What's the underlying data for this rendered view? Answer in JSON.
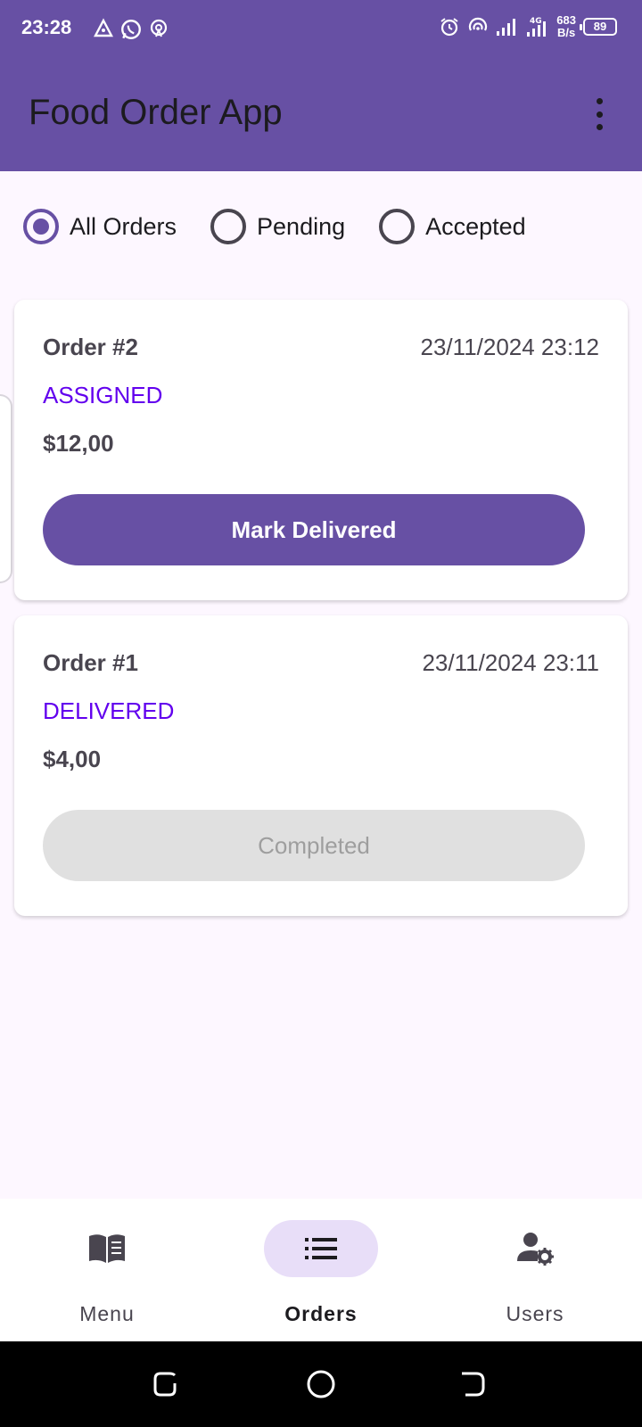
{
  "status_bar": {
    "time": "23:28",
    "left_icons": [
      "navigation-icon",
      "whatsapp-icon",
      "hotspot-icon"
    ],
    "right_icons": [
      "alarm-icon",
      "wifi-hotspot-icon",
      "signal-icon",
      "signal-4g-icon"
    ],
    "net_speed_value": "683",
    "net_speed_unit": "B/s",
    "battery": "89"
  },
  "app_bar": {
    "title": "Food Order App",
    "menu_icon": "more-vert-icon"
  },
  "filters": {
    "options": [
      {
        "label": "All Orders",
        "checked": true
      },
      {
        "label": "Pending",
        "checked": false
      },
      {
        "label": "Accepted",
        "checked": false
      }
    ]
  },
  "orders": [
    {
      "id": "Order #2",
      "datetime": "23/11/2024 23:12",
      "status": "ASSIGNED",
      "price": "$12,00",
      "action": "Mark Delivered",
      "action_enabled": true
    },
    {
      "id": "Order #1",
      "datetime": "23/11/2024 23:11",
      "status": "DELIVERED",
      "price": "$4,00",
      "action": "Completed",
      "action_enabled": false
    }
  ],
  "bottom_nav": {
    "items": [
      {
        "label": "Menu",
        "icon": "menu-book-icon",
        "active": false
      },
      {
        "label": "Orders",
        "icon": "list-icon",
        "active": true
      },
      {
        "label": "Users",
        "icon": "manage-accounts-icon",
        "active": false
      }
    ]
  },
  "colors": {
    "primary": "#6750a4",
    "status_text": "#6200ee",
    "nav_active_pill": "#e8def8",
    "disabled_button": "#e0e0e0"
  }
}
